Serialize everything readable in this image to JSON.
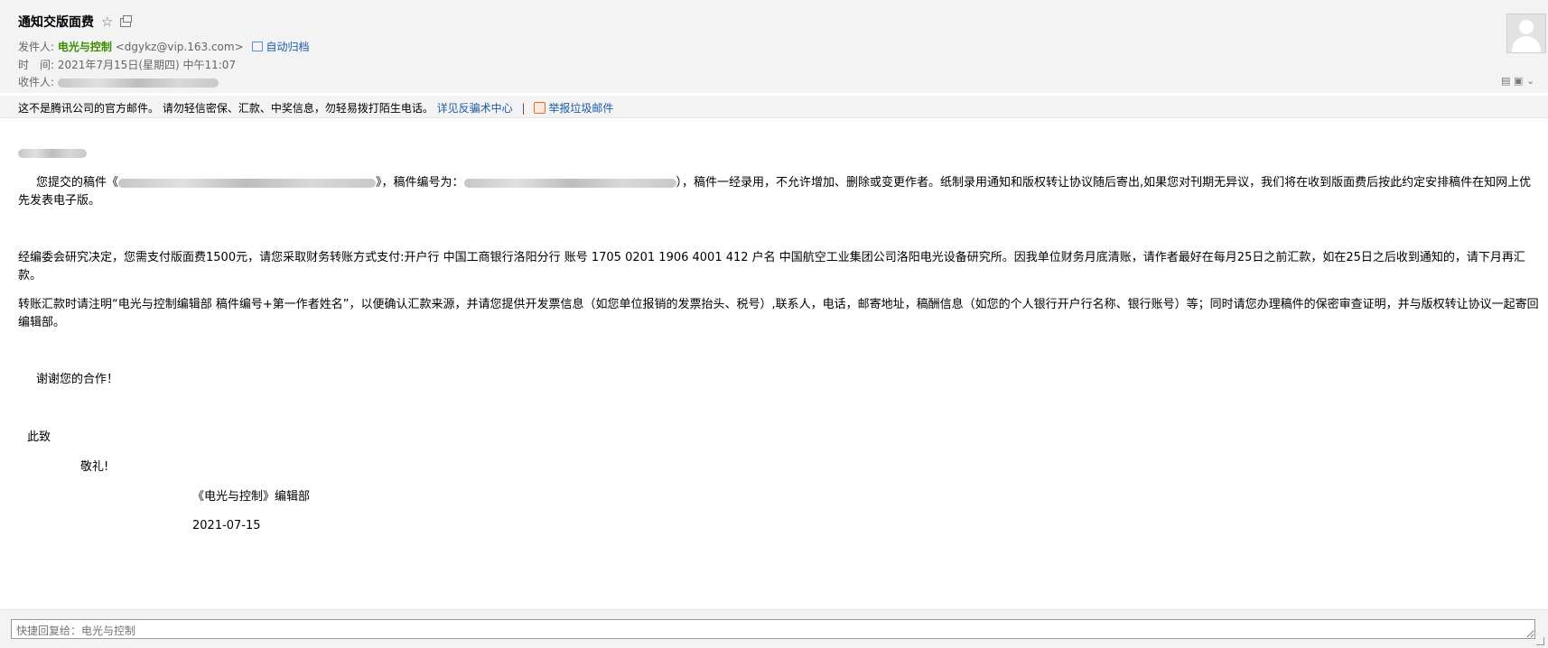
{
  "email": {
    "subject": "通知交版面费",
    "sender_label": "发件人:",
    "sender_name": "电光与控制",
    "sender_addr": "<dgykz@vip.163.com>",
    "auto_archive": "自动归档",
    "time_label": "时　间:",
    "time_value": "2021年7月15日(星期四) 中午11:07",
    "recipient_label": "收件人:"
  },
  "warning": {
    "text": "这不是腾讯公司的官方邮件。 请勿轻信密保、汇款、中奖信息，勿轻易拨打陌生电话。",
    "link": "详见反骗术中心",
    "separator": "|",
    "report": "举报垃圾邮件"
  },
  "body": {
    "para1_a": "您提交的稿件《",
    "para1_b": "》，稿件编号为：",
    "para1_c": "），稿件一经录用，不允许增加、删除或变更作者。纸制录用通知和版权转让协议随后寄出,如果您对刊期无异议，我们将在收到版面费后按此约定安排稿件在知网上优先发表电子版。",
    "para2": "经编委会研究决定，您需支付版面费1500元，请您采取财务转账方式支付:开户行 中国工商银行洛阳分行  账号 1705 0201 1906 4001 412 户名 中国航空工业集团公司洛阳电光设备研究所。因我单位财务月底清账，请作者最好在每月25日之前汇款，如在25日之后收到通知的，请下月再汇款。",
    "para3": "转账汇款时请注明“电光与控制编辑部 稿件编号+第一作者姓名”，以便确认汇款来源，并请您提供开发票信息（如您单位报销的发票抬头、税号）,联系人，电话，邮寄地址，稿酬信息（如您的个人银行开户行名称、银行账号）等；同时请您办理稿件的保密审查证明，并与版权转让协议一起寄回编辑部。",
    "thanks": "谢谢您的合作！",
    "cizhi": "此致",
    "jingli": "敬礼!",
    "signature": "《电光与控制》编辑部",
    "date": "2021-07-15"
  },
  "reply": {
    "placeholder": "快捷回复给：电光与控制"
  },
  "colors": {
    "header_bg": "#f3f3f3",
    "sender_green": "#3c8d00",
    "link_blue": "#1d5ca8"
  }
}
